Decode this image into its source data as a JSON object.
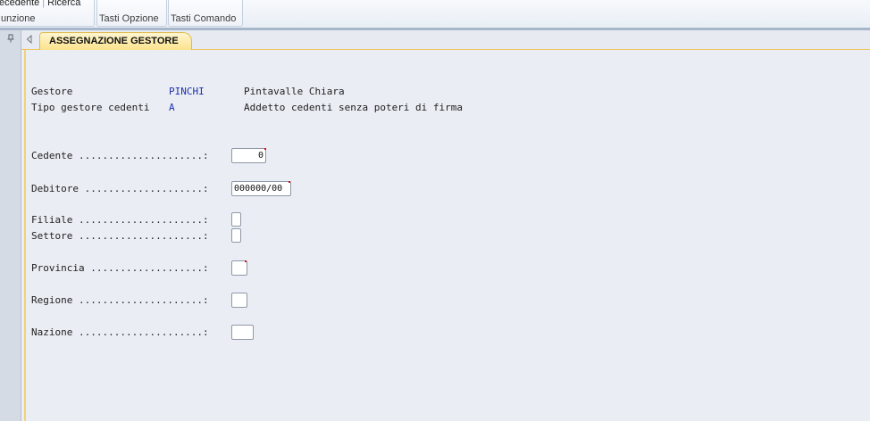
{
  "ribbon": {
    "group1": {
      "btn_prev": "ecedente",
      "btn_search": "Ricerca",
      "label": "unzione"
    },
    "group2": {
      "label": "Tasti Opzione"
    },
    "group3": {
      "label": "Tasti Comando"
    }
  },
  "tabs": {
    "active": "ASSEGNAZIONE GESTORE"
  },
  "header": {
    "gestore_label": "Gestore",
    "gestore_code": "PINCHI",
    "gestore_name": "Pintavalle Chiara",
    "tipo_label": "Tipo gestore cedenti",
    "tipo_code": "A",
    "tipo_desc": "Addetto cedenti senza poteri di firma"
  },
  "fields": {
    "cedente": {
      "label": "Cedente .....................:",
      "value": "0"
    },
    "debitore": {
      "label": "Debitore ....................:",
      "value": "000000/00"
    },
    "filiale": {
      "label": "Filiale .....................:",
      "value": ""
    },
    "settore": {
      "label": "Settore .....................:",
      "value": ""
    },
    "provincia": {
      "label": "Provincia ...................:",
      "value": ""
    },
    "regione": {
      "label": "Regione .....................:",
      "value": ""
    },
    "nazione": {
      "label": "Nazione .....................:",
      "value": ""
    }
  },
  "colors": {
    "tab_active": "#fbe28c",
    "panel_bg": "#eaeef4",
    "code_text": "#1f2fb0",
    "required_marker": "#e01010"
  },
  "icons": {
    "pin": "pin-icon",
    "nav": "chevron-left-icon"
  }
}
